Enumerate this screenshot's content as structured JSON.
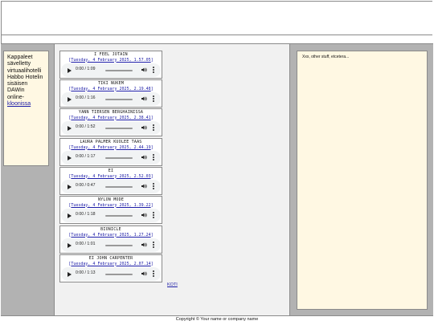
{
  "sidebar_left": {
    "text_lines": [
      "Kappaleet",
      "sävelletty",
      "virtuaalihotelli",
      "Habbo Hotelin",
      "sisäisen",
      "DAWin",
      "online-"
    ],
    "link_text": "kloonissa"
  },
  "sidebar_right": {
    "text": "Xxx, other stuff, etcetera..."
  },
  "tracks": [
    {
      "title": "I FEEL JOTAIN",
      "date": "Tuesday, 4 February 2025, 1.57.05",
      "time": "0:00 / 1:09",
      "progress": 0
    },
    {
      "title": "TIKI NUKEM",
      "date": "Tuesday, 4 February 2025, 2.19.48",
      "time": "0:00 / 1:16",
      "progress": 0
    },
    {
      "title": "YANN TIERSEN BERGHAINISSA",
      "date": "Tuesday, 4 February 2025, 2.38.41",
      "time": "0:00 / 1:52",
      "progress": 0
    },
    {
      "title": "LAURA PALMER KUOLEE TAAS",
      "date": "Tuesday, 4 February 2025, 2.44.19",
      "time": "0:00 / 1:17",
      "progress": 0
    },
    {
      "title": "EI",
      "date": "Tuesday, 4 February 2025, 2.52.03",
      "time": "0:00 / 0:47",
      "progress": 0
    },
    {
      "title": "NYLON MODE",
      "date": "Tuesday, 4 February 2025, 1.39.22",
      "time": "0:00 / 1:18",
      "progress": 0
    },
    {
      "title": "BIONICLE",
      "date": "Tuesday, 4 February 2025, 1.27.24",
      "time": "0:00 / 1:01",
      "progress": 0
    },
    {
      "title": "EI JOHN CARPENTER",
      "date": "Tuesday, 4 February 2025, 2.07.14",
      "time": "0:00 / 1:13",
      "progress": 0
    }
  ],
  "icons": {
    "play": "play-icon",
    "volume": "volume-icon",
    "menu": "more-vertical-icon"
  },
  "home_link": "KOTI",
  "footer": "Copyright © Your name or company name",
  "colors": {
    "link": "#1a1aa6",
    "sidebar_box": "#fff8e3",
    "column_gray": "#b2b2b2",
    "center_bg": "#f1f1f1"
  }
}
